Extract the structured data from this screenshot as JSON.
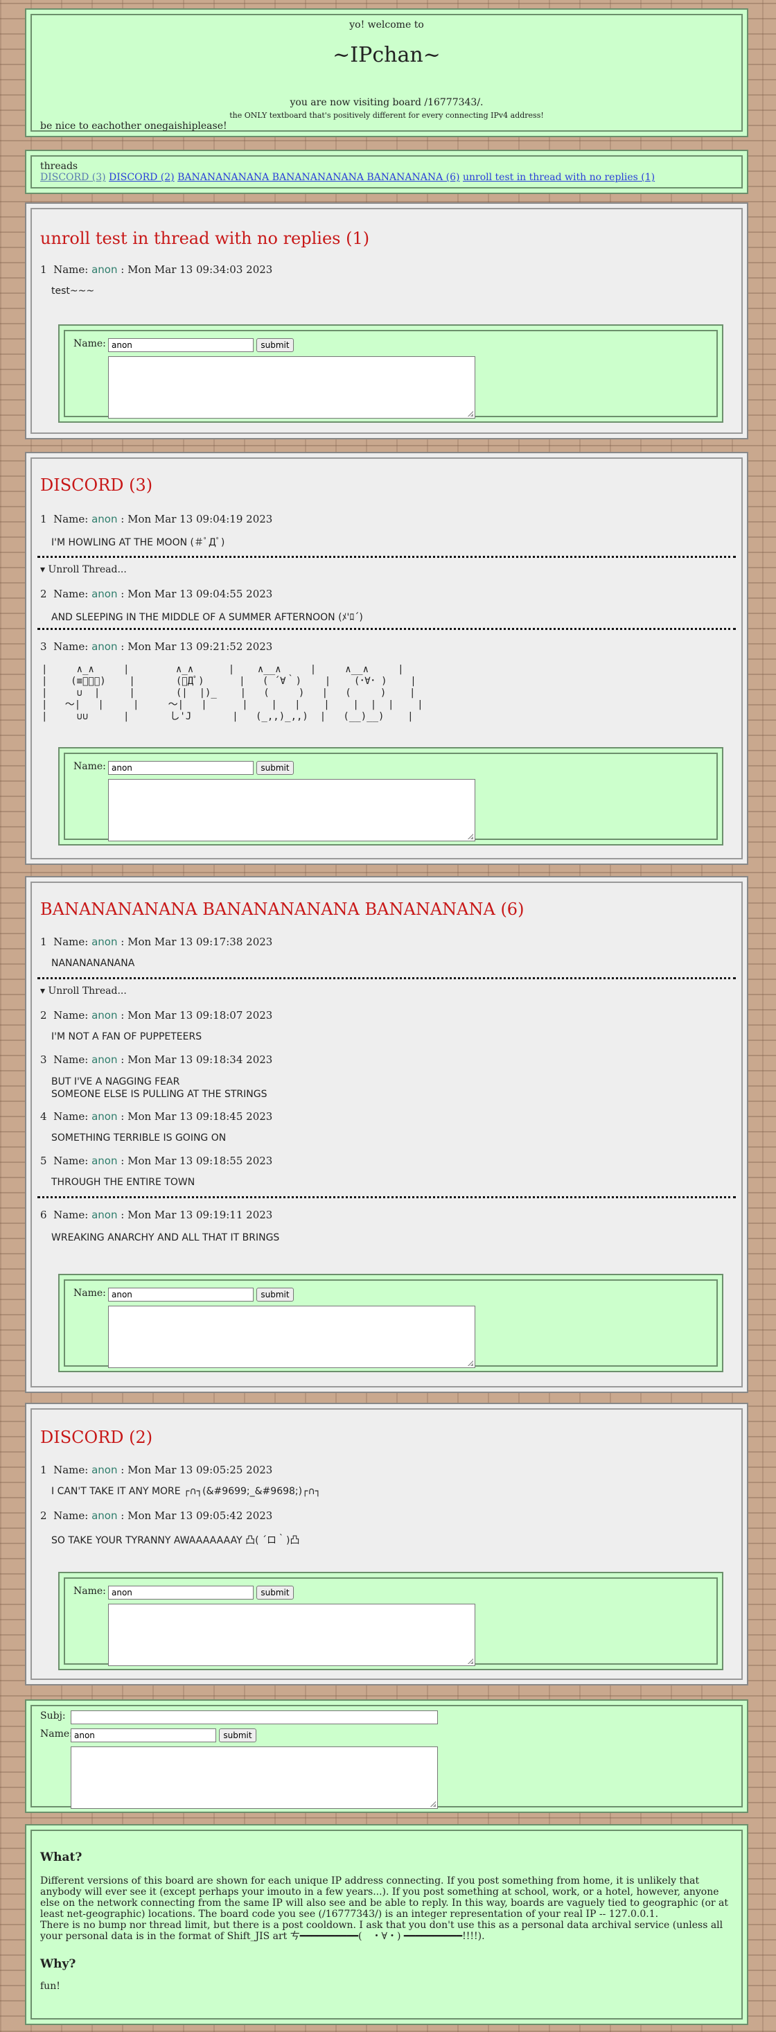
{
  "header": {
    "greeting": "yo! welcome to",
    "site_name": "~IPchan~",
    "visiting": "you are now visiting board /16777343/.",
    "tagline": "the ONLY textboard that's positively different for every connecting IPv4 address!",
    "be_nice": "be nice to eachother onegaishiplease!"
  },
  "threads_nav": {
    "heading": "threads",
    "links": [
      "DISCORD (3)",
      "DISCORD (2)",
      "BANANANANANA BANANANANANA BANANANANA (6)",
      "unroll test in thread with no replies (1)"
    ]
  },
  "form": {
    "name_label": "Name:",
    "name_value": "anon",
    "submit_label": "submit",
    "subj_label": "Subj:"
  },
  "threads": [
    {
      "title": "unroll test in thread with no replies (1)",
      "posts": [
        {
          "num": "1",
          "name_label": "Name:",
          "name": "anon",
          "date": ": Mon Mar 13 09:34:03 2023",
          "body": "test~~~"
        }
      ]
    },
    {
      "title": "DISCORD (3)",
      "unroll": "▾ Unroll Thread...",
      "posts": [
        {
          "num": "1",
          "name_label": "Name:",
          "name": "anon",
          "date": ": Mon Mar 13 09:04:19 2023",
          "body": "I'M HOWLING AT THE MOON (＃ﾟДﾟ)"
        },
        {
          "num": "2",
          "name_label": "Name:",
          "name": "anon",
          "date": ": Mon Mar 13 09:04:55 2023",
          "body": "AND SLEEPING IN THE MIDDLE OF A SUMMER AFTERNOON (ﾒ'ﾛ´)"
        },
        {
          "num": "3",
          "name_label": "Name:",
          "name": "anon",
          "date": ": Mon Mar 13 09:21:52 2023",
          "body": "|     ∧_∧     |        ∧_∧      |    ∧__∧     |     ∧__∧     |\n|    (≡ﾟ－ﾟ)    |       (ﾟДﾟ)      |   ( ´∀｀)    |    (･∀･ )    |\n|     ∪  |     |       (|  |)_    |   (     )   |   (     )    |\n|   ～|   |     |     ～|   |      |    |   |    |    |  |  |    |\n|     ∪∪      |       し'J       |   (_,,)_,,)  |   (__)__)    |"
        }
      ]
    },
    {
      "title": "BANANANANANA BANANANANANA BANANANANA (6)",
      "unroll": "▾ Unroll Thread...",
      "posts": [
        {
          "num": "1",
          "name_label": "Name:",
          "name": "anon",
          "date": ": Mon Mar 13 09:17:38 2023",
          "body": "NANANANANANA"
        },
        {
          "num": "2",
          "name_label": "Name:",
          "name": "anon",
          "date": ": Mon Mar 13 09:18:07 2023",
          "body": "I'M NOT A FAN OF PUPPETEERS"
        },
        {
          "num": "3",
          "name_label": "Name:",
          "name": "anon",
          "date": ": Mon Mar 13 09:18:34 2023",
          "body": "BUT I'VE A NAGGING FEAR\nSOMEONE ELSE IS PULLING AT THE STRINGS"
        },
        {
          "num": "4",
          "name_label": "Name:",
          "name": "anon",
          "date": ": Mon Mar 13 09:18:45 2023",
          "body": "SOMETHING TERRIBLE IS GOING ON"
        },
        {
          "num": "5",
          "name_label": "Name:",
          "name": "anon",
          "date": ": Mon Mar 13 09:18:55 2023",
          "body": "THROUGH THE ENTIRE TOWN"
        },
        {
          "num": "6",
          "name_label": "Name:",
          "name": "anon",
          "date": ": Mon Mar 13 09:19:11 2023",
          "body": "WREAKING ANARCHY AND ALL THAT IT BRINGS"
        }
      ]
    },
    {
      "title": "DISCORD (2)",
      "posts": [
        {
          "num": "1",
          "name_label": "Name:",
          "name": "anon",
          "date": ": Mon Mar 13 09:05:25 2023",
          "body": "I CAN'T TAKE IT ANY MORE ┌∩┐(&#9699;_&#9698;)┌∩┐"
        },
        {
          "num": "2",
          "name_label": "Name:",
          "name": "anon",
          "date": ": Mon Mar 13 09:05:42 2023",
          "body": "SO TAKE YOUR TYRANNY AWAAAAAAAY 凸( ´ロ｀)凸"
        }
      ]
    }
  ],
  "about": {
    "what_heading": "What?",
    "what_text_1": "Different versions of this board are shown for each unique IP address connecting. If you post something from home, it is unlikely that anybody will ever see it (except perhaps your imouto in a few years...). If you post something at school, work, or a hotel, however, anyone else on the network connecting from the same IP will also see and be able to reply. In this way, boards are vaguely tied to geographic (or at least net-geographic) locations. The board code you see (/16777343/) is an integer representation of your real IP -- 127.0.0.1.",
    "what_text_2": "There is no bump nor thread limit, but there is a post cooldown. I ask that you don't use this as a personal data archival service (unless all your personal data is in the format of Shift_JIS art ㄘ━━━━━━━━━━(　・∀・) ━━━━━━━━━━!!!!).",
    "why_heading": "Why?",
    "why_text": "fun!"
  },
  "colors": {
    "panel_green": "#ccffcc",
    "panel_gray": "#eeeeee",
    "title_red": "#c81818",
    "name_green": "#2e7d6b",
    "link_blue": "#2a3fd8"
  }
}
